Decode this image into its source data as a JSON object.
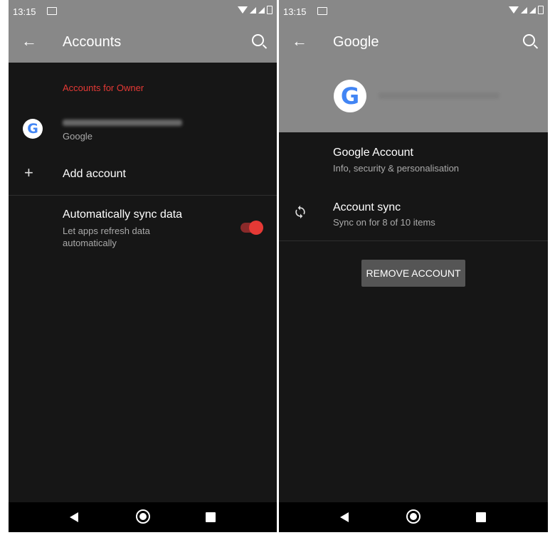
{
  "left": {
    "status": {
      "time": "13:15"
    },
    "appbar": {
      "back": "←",
      "title": "Accounts"
    },
    "section_header": "Accounts for Owner",
    "account": {
      "provider": "Google"
    },
    "add_account": {
      "icon": "+",
      "label": "Add account"
    },
    "sync": {
      "title": "Automatically sync data",
      "subtitle_line1": "Let apps refresh data",
      "subtitle_line2": "automatically",
      "enabled": true
    }
  },
  "right": {
    "status": {
      "time": "13:15"
    },
    "appbar": {
      "back": "←",
      "title": "Google"
    },
    "google_account": {
      "title": "Google Account",
      "subtitle": "Info, security & personalisation"
    },
    "account_sync": {
      "icon": "sync-icon",
      "title": "Account sync",
      "subtitle": "Sync on for 8 of 10 items"
    },
    "remove_button": "REMOVE ACCOUNT"
  },
  "icons": {
    "google_logo_letter": "G"
  },
  "colors": {
    "accent": "#e53935",
    "header": "#888888",
    "background": "#161616"
  }
}
